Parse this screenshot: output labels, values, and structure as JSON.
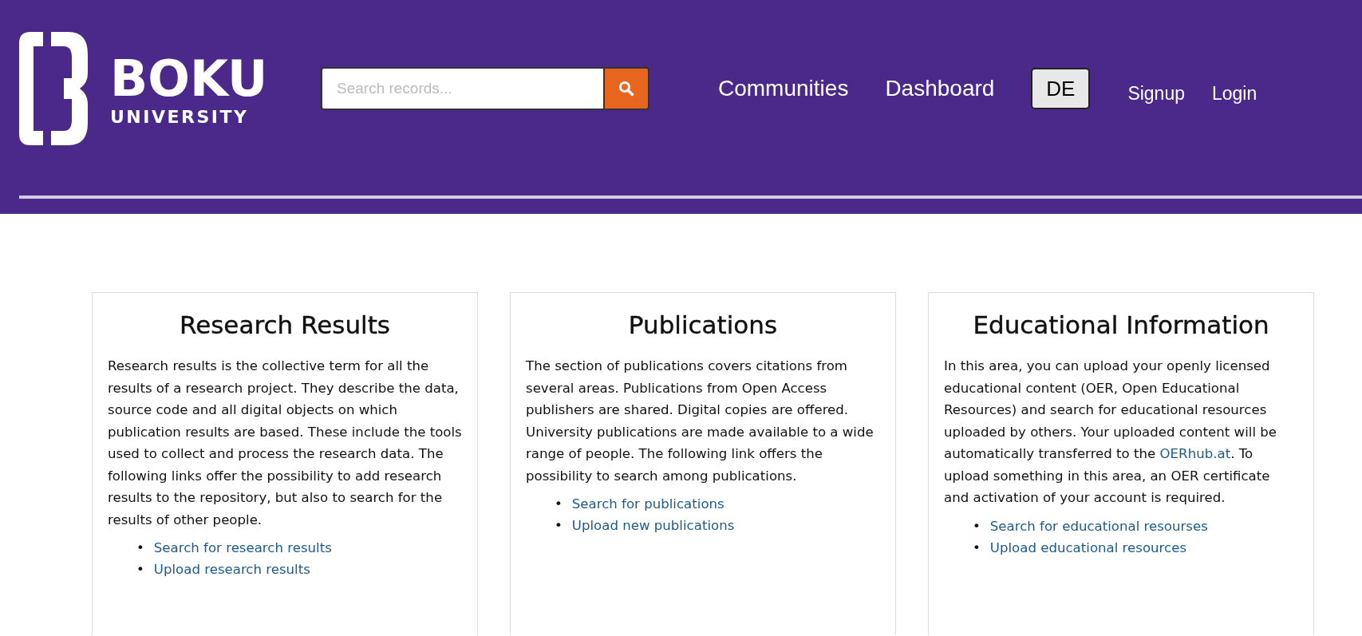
{
  "header": {
    "logo": {
      "title": "BOKU",
      "subtitle": "UNIVERSITY"
    },
    "search": {
      "placeholder": "Search records..."
    },
    "nav": [
      "Communities",
      "Dashboard"
    ],
    "language_button": "DE",
    "auth_links": [
      "Signup",
      "Login"
    ]
  },
  "cards": [
    {
      "title": "Research Results",
      "paragraph": [
        {
          "kind": "text",
          "text": "Research results is the collective term for all the results of a research project. They describe the data, source code and all digital objects on which publication results are based. These include the tools used to collect and process the research data. The following links offer the possibility to add research results to the repository, but also to search for the results of other people."
        }
      ],
      "links": [
        {
          "bullet": "•",
          "text": "Search for research results"
        },
        {
          "bullet": "•",
          "text": "Upload research results"
        }
      ]
    },
    {
      "title": "Publications",
      "paragraph": [
        {
          "kind": "text",
          "text": "The section of publications covers citations from several areas. Publications from Open Access publishers are shared. Digital copies are offered. University publications are made available to a wide range of people. The following link offers the possibility to search among publications."
        }
      ],
      "links": [
        {
          "bullet": "•",
          "text": "Search for publications"
        },
        {
          "bullet": "•",
          "text": "Upload new publications"
        }
      ]
    },
    {
      "title": "Educational Information",
      "paragraph": [
        {
          "kind": "text",
          "text": "In this area, you can upload your openly licensed educational content (OER, Open Educational Resources) and search for educational resources uploaded by others. Your uploaded content will be automatically transferred to the "
        },
        {
          "kind": "link",
          "text": "OERhub.at"
        },
        {
          "kind": "text",
          "text": ". To upload something in this area, an OER certificate and activation of your account is required."
        }
      ],
      "links": [
        {
          "bullet": "•",
          "text": "Search for educational resourses"
        },
        {
          "bullet": "•",
          "text": "Upload educational resources"
        }
      ]
    }
  ]
}
